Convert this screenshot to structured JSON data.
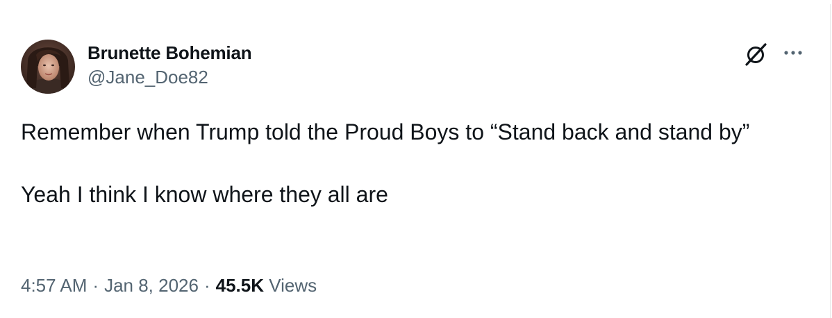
{
  "author": {
    "display_name": "Brunette Bohemian",
    "handle": "@Jane_Doe82"
  },
  "tweet": {
    "text_line1": "Remember when Trump told the Proud Boys to “Stand back and stand by”",
    "text_line2": "Yeah I think I know where they all are"
  },
  "meta": {
    "time": "4:57 AM",
    "separator": "·",
    "date": "Jan 8, 2026",
    "views_count": "45.5K",
    "views_label": "Views"
  },
  "icons": {
    "grok": "grok-icon",
    "more": "more-options-icon"
  },
  "colors": {
    "text_primary": "#0f1419",
    "text_secondary": "#536471"
  }
}
